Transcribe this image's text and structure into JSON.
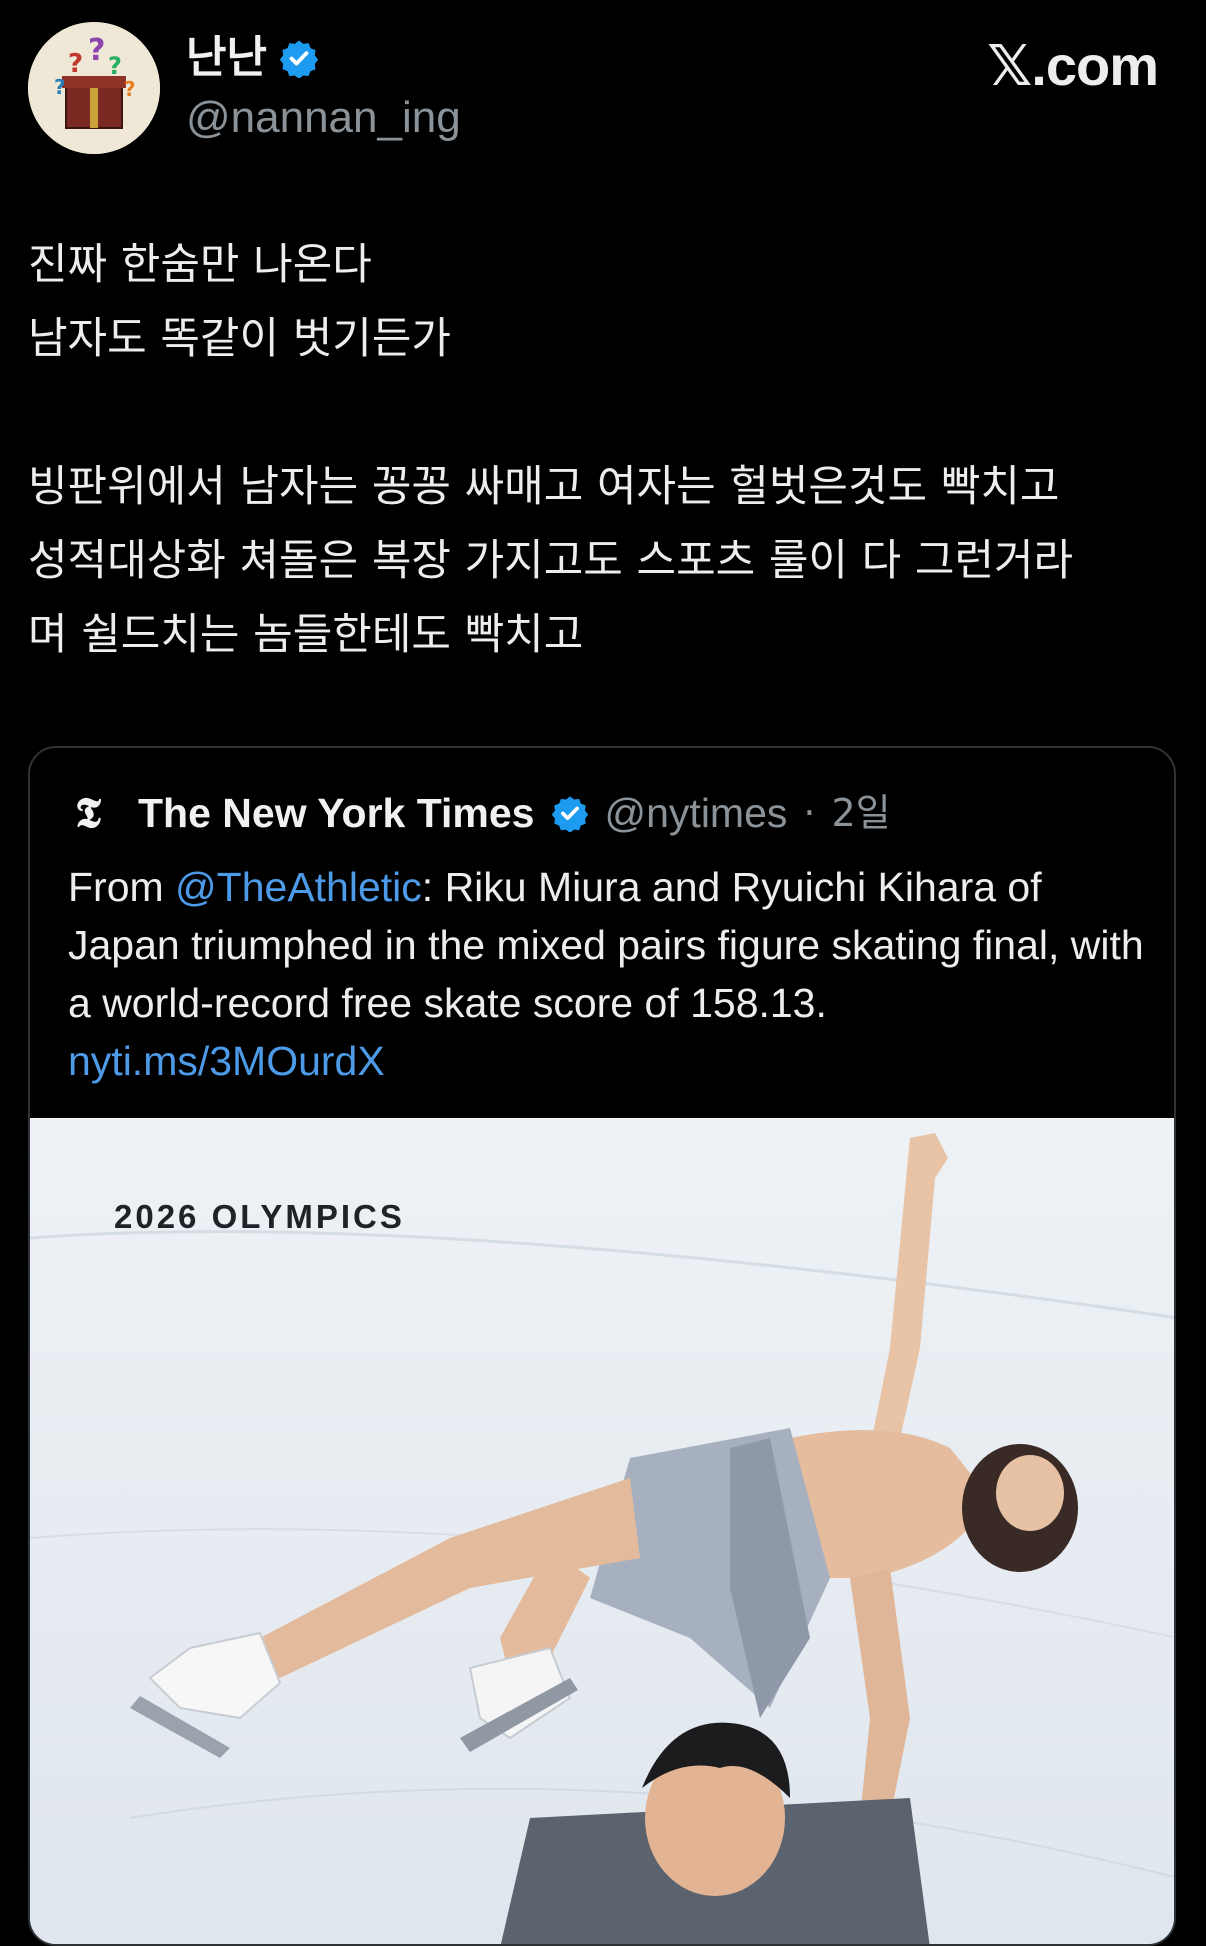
{
  "author": {
    "display_name": "난난",
    "handle": "@nannan_ing",
    "avatar_icon": "gift-box-question-avatar",
    "verified": true
  },
  "brand": "𝕏.com",
  "tweet": {
    "text": "진짜 한숨만 나온다\n남자도 똑같이 벗기든가\n\n빙판위에서 남자는 꽁꽁 싸매고 여자는 헐벗은것도 빡치고\n성적대상화 쳐돌은 복장 가지고도 스포츠 룰이 다 그런거라\n며 쉴드치는 놈들한테도 빡치고"
  },
  "quoted": {
    "logo": "𝕿",
    "name": "The New York Times",
    "handle": "@nytimes",
    "separator": "·",
    "time": "2일",
    "body_prefix": "From ",
    "body_mention": "@TheAthletic",
    "body_rest": ": Riku Miura and Ryuichi Kihara of Japan triumphed in the mixed pairs figure skating final, with a world-record free skate score of 158.13.",
    "link": "nyti.ms/3MOurdX",
    "media_label": "2026 OLYMPICS"
  },
  "colors": {
    "background": "#000000",
    "text": "#ededed",
    "muted": "#8b9399",
    "link": "#4d9be8",
    "verified": "#1d9bf0",
    "border": "#2f3336"
  }
}
